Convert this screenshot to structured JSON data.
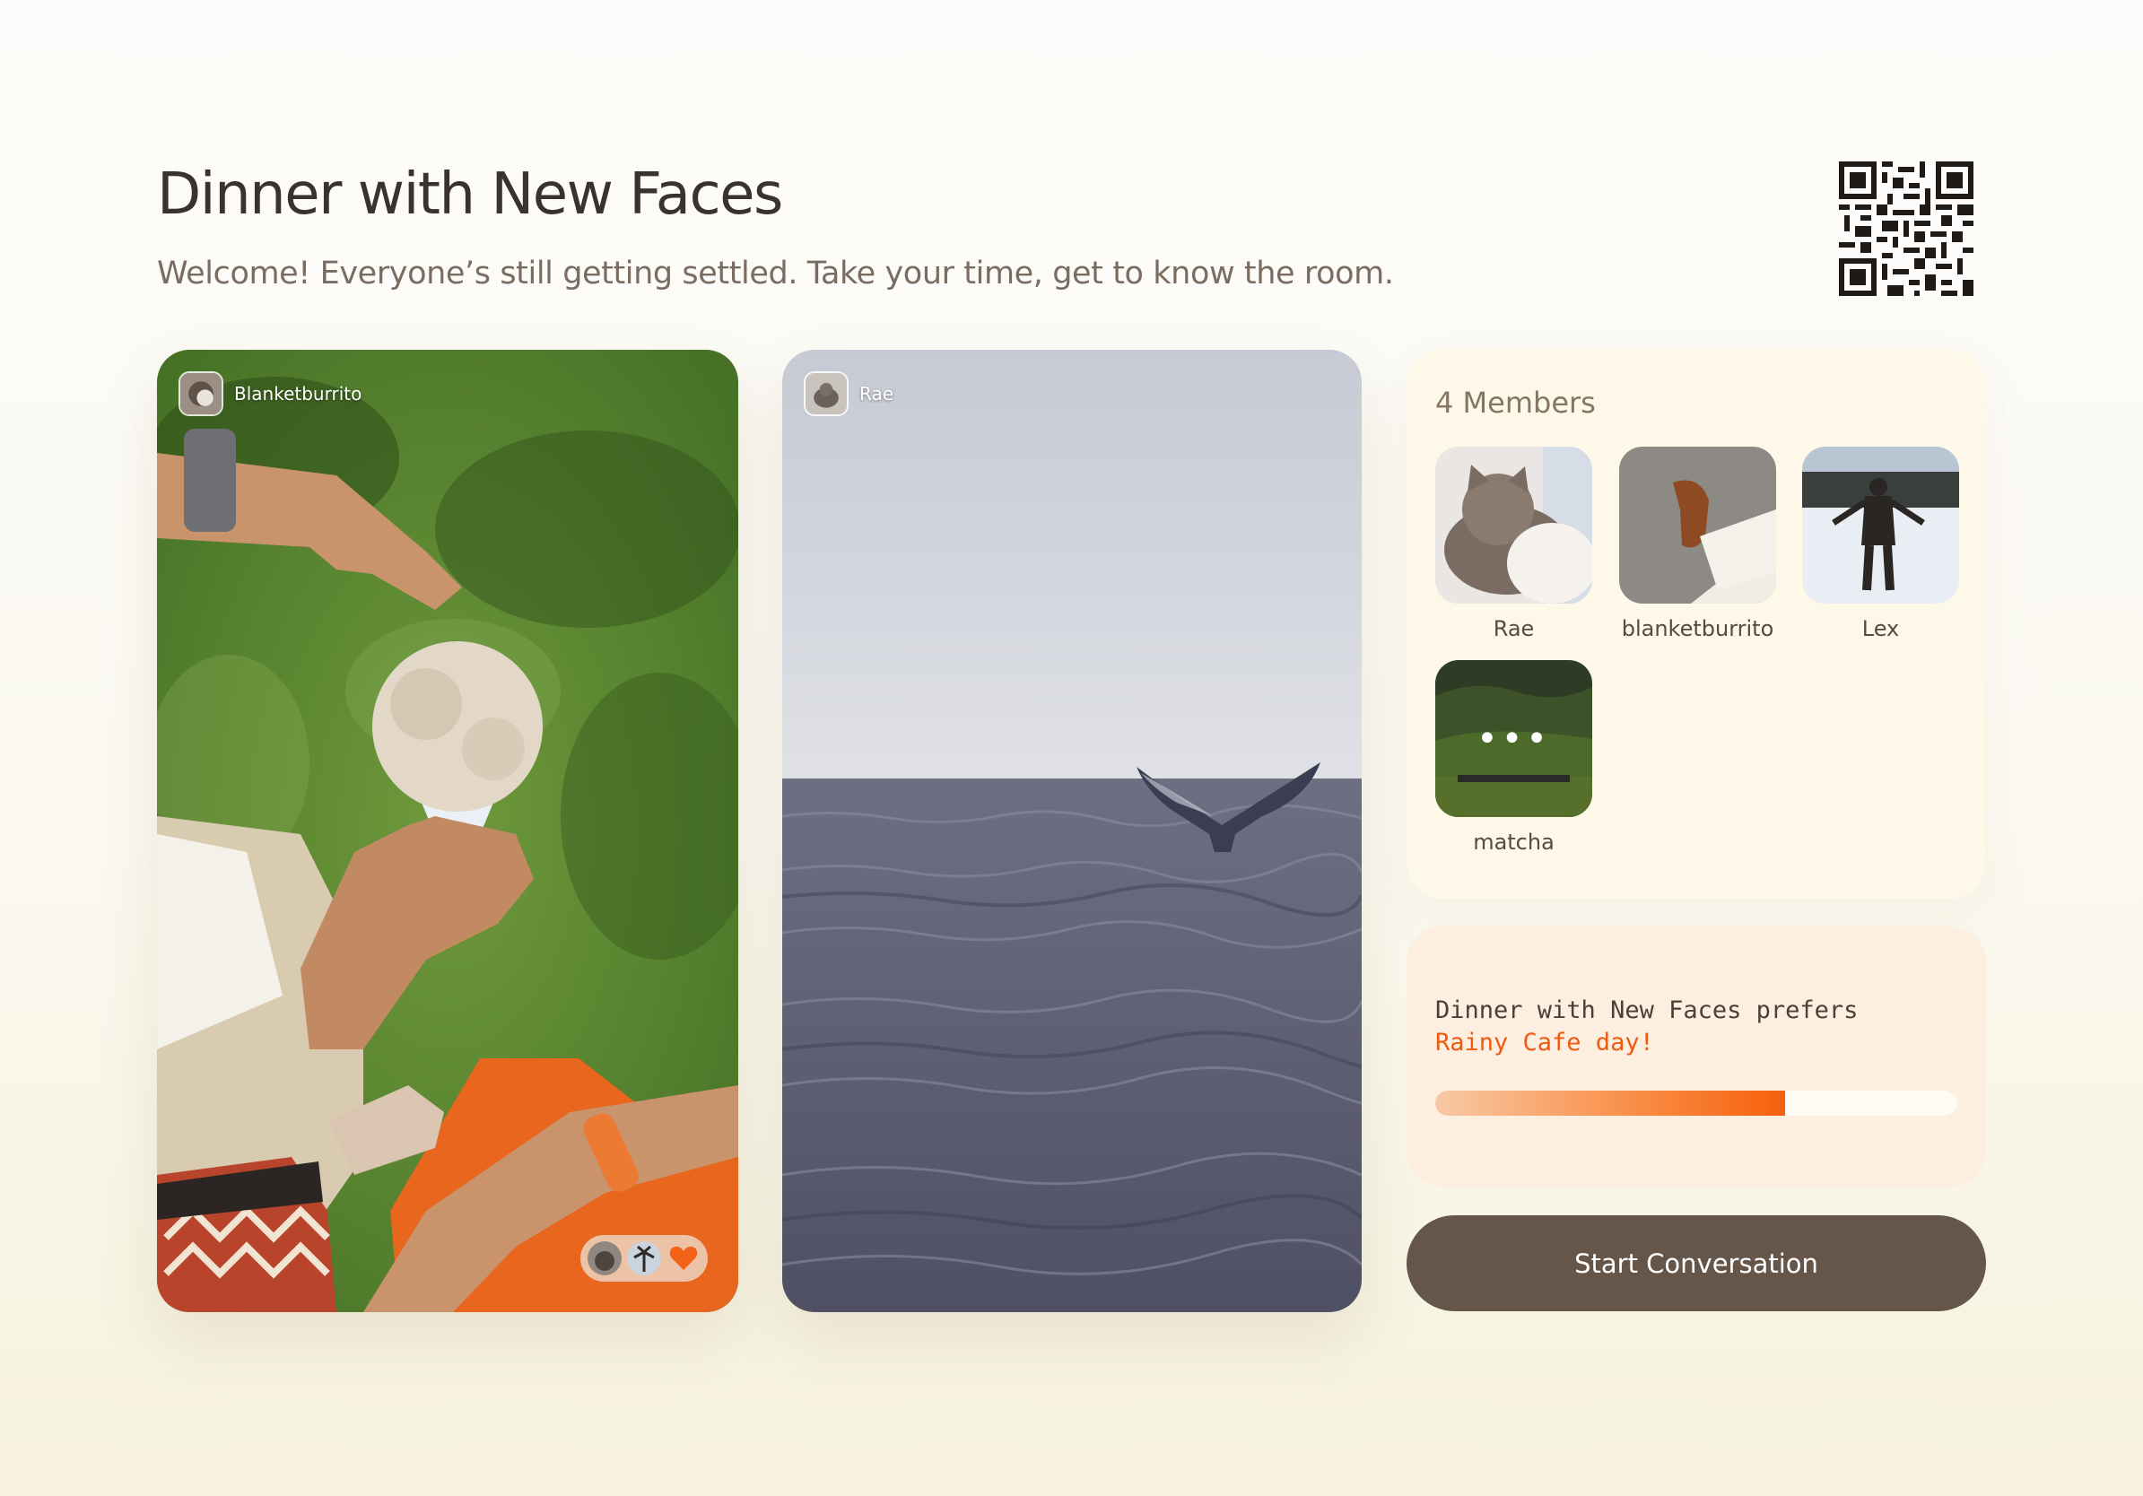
{
  "header": {
    "title": "Dinner with New Faces",
    "subtitle": "Welcome! Everyone’s still getting settled. Take your time, get to know the room."
  },
  "qr": {
    "icon": "qr-code-icon"
  },
  "posts": [
    {
      "author": "Blanketburrito",
      "image": "ice-cream-on-grass-photo"
    },
    {
      "author": "Rae",
      "image": "whale-tail-ocean-photo"
    }
  ],
  "reactions": {
    "icons": [
      "cat-avatar-icon",
      "palm-avatar-icon",
      "heart-icon"
    ]
  },
  "members": {
    "count_label": "4 Members",
    "list": [
      {
        "name": "Rae",
        "photo": "cat-photo"
      },
      {
        "name": "blanketburrito",
        "photo": "shoe-photo"
      },
      {
        "name": "Lex",
        "photo": "snow-person-photo"
      },
      {
        "name": "matcha",
        "photo": "valley-photo",
        "status": "•••"
      }
    ]
  },
  "preference": {
    "line1": "Dinner with New Faces prefers",
    "line2": "Rainy Cafe day!",
    "progress": 0.67
  },
  "actions": {
    "start_label": "Start Conversation"
  },
  "colors": {
    "accent": "#f05a10",
    "button": "#66564a",
    "members_bg": "#fdf8e8",
    "prefs_bg": "#fdefe0"
  }
}
